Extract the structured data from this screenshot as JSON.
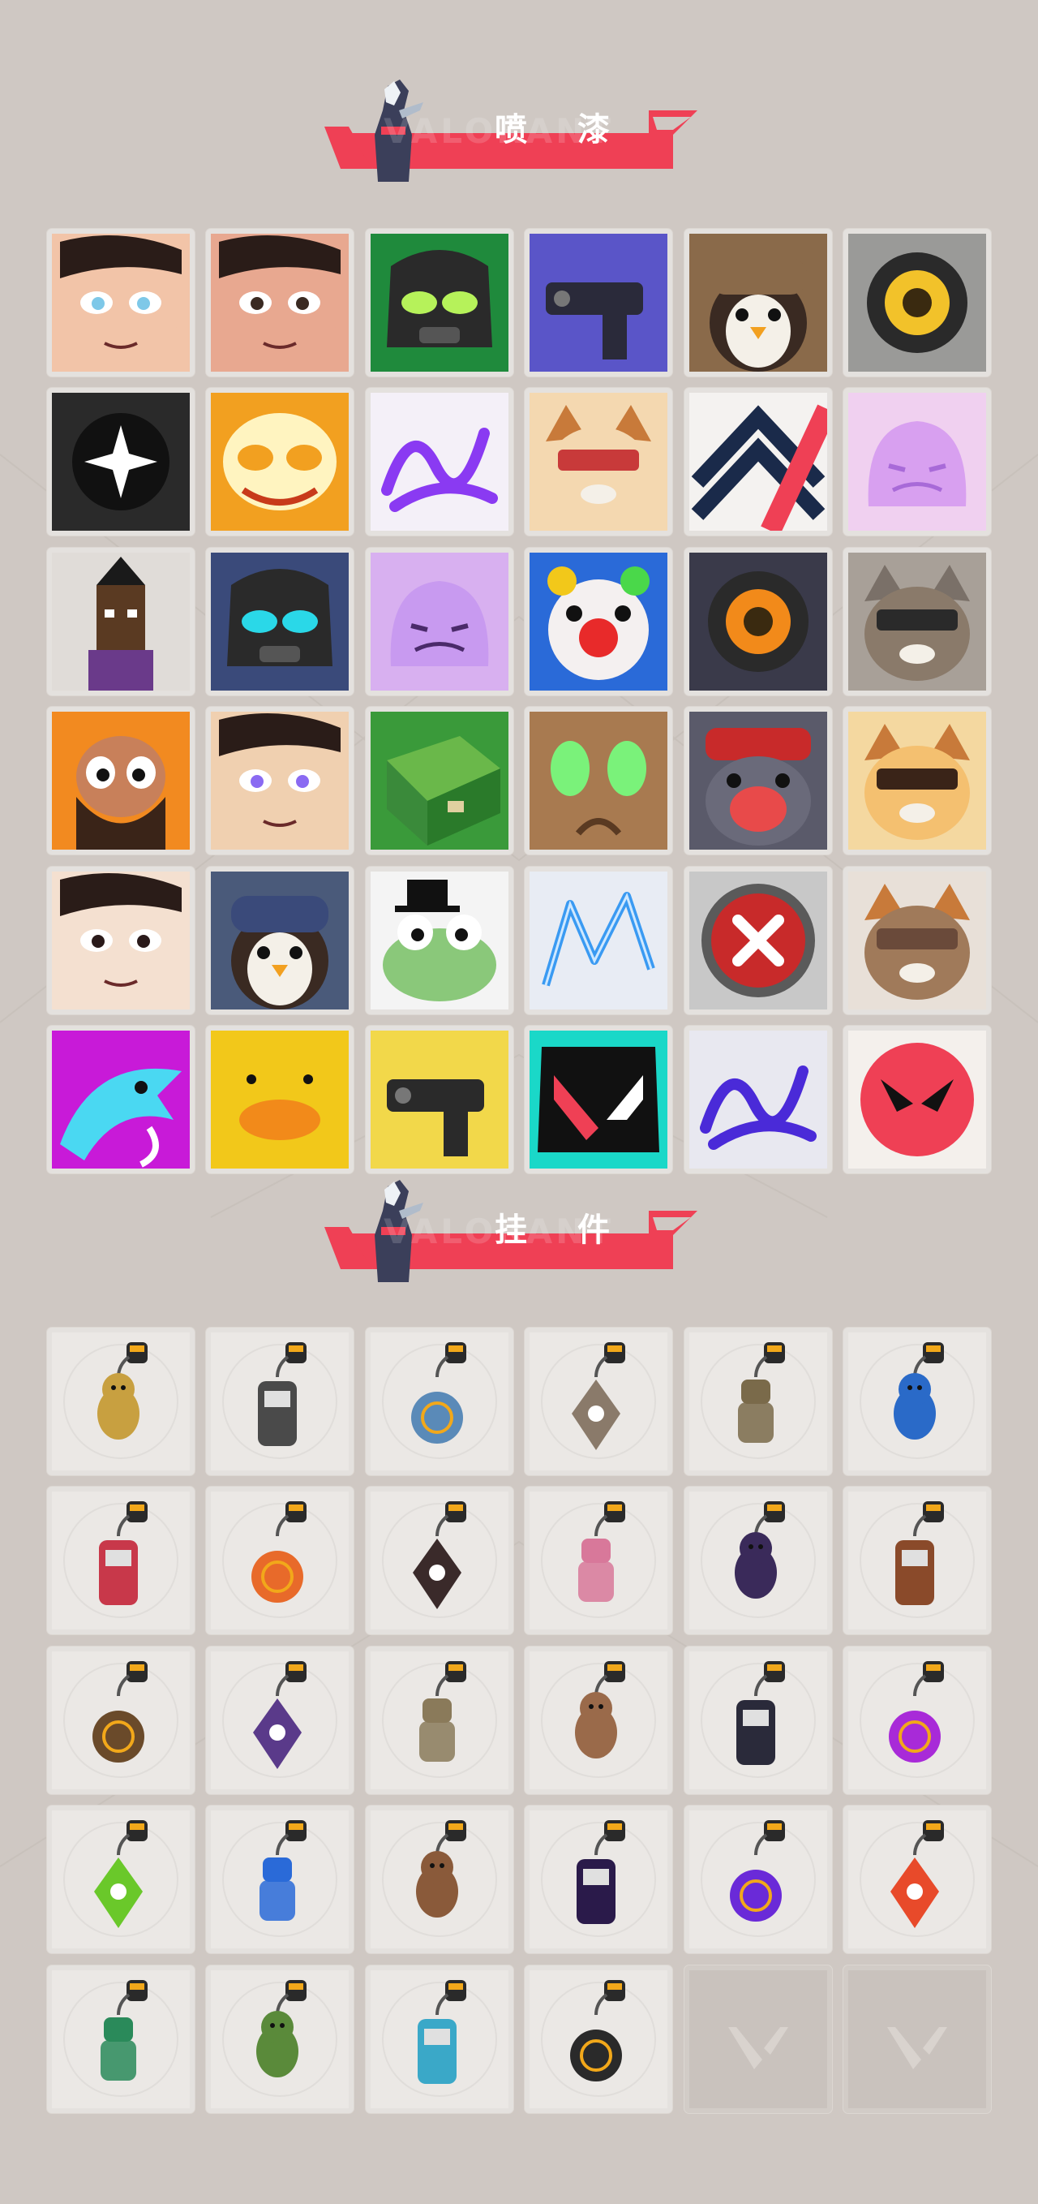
{
  "brand": {
    "watermark": "VALORANT"
  },
  "colors": {
    "background": "#cfc8c3",
    "accent": "#ef4055",
    "tile": "#e9e6e3"
  },
  "sections": [
    {
      "title": "喷 漆",
      "items": [
        {
          "icon": "blue-eyed-girl-spray-icon"
        },
        {
          "icon": "angry-boy-spray-icon"
        },
        {
          "icon": "green-helmet-spray-icon"
        },
        {
          "icon": "purple-gun-spray-icon"
        },
        {
          "icon": "penguin-hat-spray-icon"
        },
        {
          "icon": "yellow-eye-robot-spray-icon"
        },
        {
          "icon": "white-star-spray-icon"
        },
        {
          "icon": "orange-mask-spray-icon"
        },
        {
          "icon": "purple-scribble-spray-icon"
        },
        {
          "icon": "goggles-cat-spray-icon"
        },
        {
          "icon": "chevron-stripes-spray-icon"
        },
        {
          "icon": "sleeping-creature-spray-icon"
        },
        {
          "icon": "pixel-warrior-spray-icon"
        },
        {
          "icon": "armored-robot-spray-icon"
        },
        {
          "icon": "purple-ghost-spray-icon"
        },
        {
          "icon": "clown-spray-icon"
        },
        {
          "icon": "orange-gauge-spray-icon"
        },
        {
          "icon": "raccoon-sunglasses-spray-icon"
        },
        {
          "icon": "bearded-man-spray-icon"
        },
        {
          "icon": "purple-eyed-boy-spray-icon"
        },
        {
          "icon": "green-crate-spray-icon"
        },
        {
          "icon": "green-eyes-spray-icon"
        },
        {
          "icon": "crying-blob-spray-icon"
        },
        {
          "icon": "tiger-spray-icon"
        },
        {
          "icon": "side-eye-girl-spray-icon"
        },
        {
          "icon": "penguin-beanie-spray-icon"
        },
        {
          "icon": "frog-hat-spray-icon"
        },
        {
          "icon": "blue-neon-spray-icon"
        },
        {
          "icon": "red-x-button-spray-icon"
        },
        {
          "icon": "pixel-raccoon-spray-icon"
        },
        {
          "icon": "blue-dragon-spray-icon"
        },
        {
          "icon": "yellow-duck-spray-icon"
        },
        {
          "icon": "pistol-cat-spray-icon"
        },
        {
          "icon": "valorant-logo-splash-spray-icon"
        },
        {
          "icon": "purple-graffiti-spray-icon"
        },
        {
          "icon": "red-valorant-ball-spray-icon"
        }
      ]
    },
    {
      "title": "挂 件",
      "items": [
        {
          "icon": "gold-cat-buddy-icon"
        },
        {
          "icon": "drone-bot-buddy-icon"
        },
        {
          "icon": "basket-buddy-icon"
        },
        {
          "icon": "raccoon-figure-buddy-icon"
        },
        {
          "icon": "satchel-buddy-icon"
        },
        {
          "icon": "blue-canister-buddy-icon"
        },
        {
          "icon": "chainsaw-buddy-icon"
        },
        {
          "icon": "orange-bird-buddy-icon"
        },
        {
          "icon": "rope-knot-buddy-icon"
        },
        {
          "icon": "cupcake-buddy-icon"
        },
        {
          "icon": "ep9-badge-buddy-icon"
        },
        {
          "icon": "teddy-bear-buddy-icon"
        },
        {
          "icon": "toolbox-buddy-icon"
        },
        {
          "icon": "agent-figure-buddy-icon"
        },
        {
          "icon": "cowboy-figure-buddy-icon"
        },
        {
          "icon": "cardboard-box-buddy-icon"
        },
        {
          "icon": "black-puppet-buddy-icon"
        },
        {
          "icon": "lava-lamp-buddy-icon"
        },
        {
          "icon": "green-pager-buddy-icon"
        },
        {
          "icon": "blue-astronaut-buddy-icon"
        },
        {
          "icon": "handheld-console-buddy-icon"
        },
        {
          "icon": "ep9-badge-buddy-icon"
        },
        {
          "icon": "purple-pixel-heart-buddy-icon"
        },
        {
          "icon": "fire-stack-buddy-icon"
        },
        {
          "icon": "green-can-buddy-icon"
        },
        {
          "icon": "green-goblin-buddy-icon"
        },
        {
          "icon": "ufo-buddy-icon"
        },
        {
          "icon": "valorant-medal-buddy-icon"
        },
        {
          "icon": "valorant-placeholder-icon"
        },
        {
          "icon": "valorant-placeholder-icon"
        }
      ]
    }
  ]
}
